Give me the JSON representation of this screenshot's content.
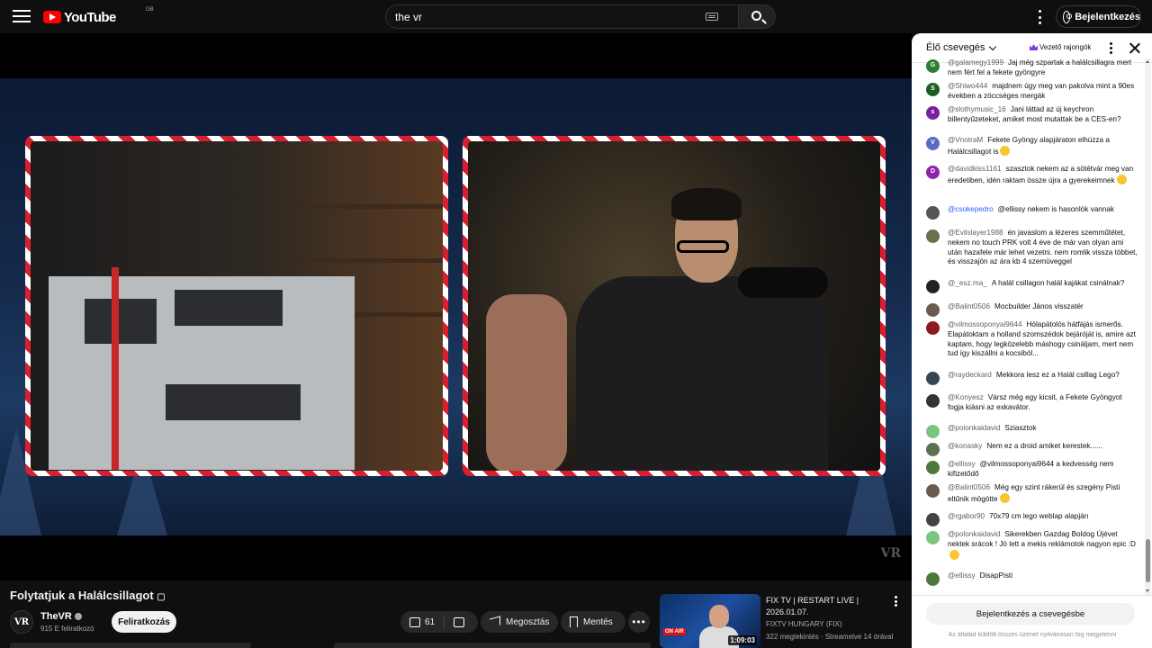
{
  "header": {
    "logo_text": "YouTube",
    "region": "GB",
    "search_value": "the vr",
    "signin_label": "Bejelentkezés"
  },
  "video": {
    "watermark": "VR",
    "title": "Folytatjuk a Halálcsillagot",
    "title_suffix": "▢",
    "channel_name": "TheVR",
    "channel_avatar_text": "VR",
    "subscribers": "915 E feliratkozó",
    "subscribe_label": "Feliratkozás",
    "likes": "61",
    "share_label": "Megosztás",
    "save_label": "Mentés",
    "more_label": "•••"
  },
  "related": {
    "title": "FIX TV | RESTART LIVE | 2026.01.07.",
    "channel": "FIXTV HUNGARY (FIX)",
    "meta": "322 megtekintés · Streamelve 14 órával",
    "duration": "1:09:03",
    "badge": "ON AIR"
  },
  "chat": {
    "mode_label": "Élő csevegés",
    "top_fans_label": "Vezető rajongók",
    "signin_label": "Bejelentkezés a csevegésbe",
    "note": "Az általad küldött összes üzenet nyilvánosan fog megjelenni",
    "messages": [
      {
        "author": "@galamegy1999",
        "text": "Jaj még szpartak a halálcsillagra mert nem fért fel a fekete gyöngyre",
        "initial": "G",
        "color": "#2e7d32"
      },
      {
        "author": "@Shiwo444",
        "text": "majdnem úgy meg van pakolva mint a 90es években a zöccséges mergák",
        "initial": "S",
        "color": "#1b5e20"
      },
      {
        "author": "@slothymusic_16",
        "text": "Jani láttad az új keychron billentyűzeteket, amiket most mutattak be a CES-en?",
        "initial": "s",
        "color": "#7b1fa2"
      },
      {
        "author": "@VnotraM",
        "text": "Fekete Gyöngy alapjáraton elhúzza a Halálcsillagot is",
        "initial": "V",
        "color": "#5c6bc0",
        "emoji": true
      },
      {
        "author": "@davidkiss1161",
        "text": "szasztok nekem az a sötétvár meg van eredetiben, idén raktam össze újra a gyerekeimnek",
        "initial": "D",
        "color": "#8e24aa",
        "emoji": true
      },
      {
        "author": "@csokepedro",
        "text": "@ellissy nekem is hasonlók vannak",
        "initial": "",
        "color": "#555555",
        "highlight": true
      },
      {
        "author": "@Evilslayer1988",
        "text": "én javaslom a lézeres szemműtétet, nekem no touch PRK volt 4 éve de már van olyan ami után hazafele már lehet vezetni. nem romlik vissza többet, és visszajön az ára kb 4 szemüveggel",
        "initial": "",
        "color": "#6d6f4a"
      },
      {
        "author": "@_esz.ma_",
        "text": "A halál csillagon halál kajákat csinálnak?",
        "initial": "",
        "color": "#222222"
      },
      {
        "author": "@Balint0506",
        "text": "Mocbuilder János visszatér",
        "initial": "",
        "color": "#6b5a4e"
      },
      {
        "author": "@vilmossoponyai9644",
        "text": "Hólapátolós hátfájás ismerős. Elapátoktam a holland szomszédok bejáróját is, amire azt kaptam, hogy legközelebb máshogy csináljam, mert nem tud így kiszállni a kocsiból...",
        "initial": "",
        "color": "#8e1b1b"
      },
      {
        "author": "@raydeckard",
        "text": "Mekkora lesz ez a Halál csillag Lego?",
        "initial": "",
        "color": "#37474f"
      },
      {
        "author": "@Konyesz",
        "text": "Vársz még egy kicsit, a Fekete Gyöngyot fogja kiásni az exkavátor.",
        "initial": "",
        "color": "#333333"
      },
      {
        "author": "@polonkaidavid",
        "text": "Sziasztok",
        "initial": "",
        "color": "#7cc47f"
      },
      {
        "author": "@konasky",
        "text": "Nem ez a droid amiket kerestek......",
        "initial": "",
        "color": "#5b6f53"
      },
      {
        "author": "@ellissy",
        "text": "@vilmossoponyai9644 a kedvesség nem kifizetődő",
        "initial": "",
        "color": "#4d7a3a"
      },
      {
        "author": "@Balint0506",
        "text": "Még egy szint rákerül és szegény Pisti eltűnik mögötte",
        "initial": "",
        "color": "#6b5a4e",
        "emoji": true
      },
      {
        "author": "@rgabor90",
        "text": "70x79 cm lego weblap alapján",
        "initial": "",
        "color": "#444444"
      },
      {
        "author": "@polonkaidavid",
        "text": "Sikerekben Gazdag Boldog Újévet nektek srácok ! Jó lett a mekis reklámotok nagyon epic :D",
        "initial": "",
        "color": "#7cc47f",
        "emoji": true
      },
      {
        "author": "@ellissy",
        "text": "DisapPisti",
        "initial": "",
        "color": "#4d7a3a"
      }
    ]
  }
}
